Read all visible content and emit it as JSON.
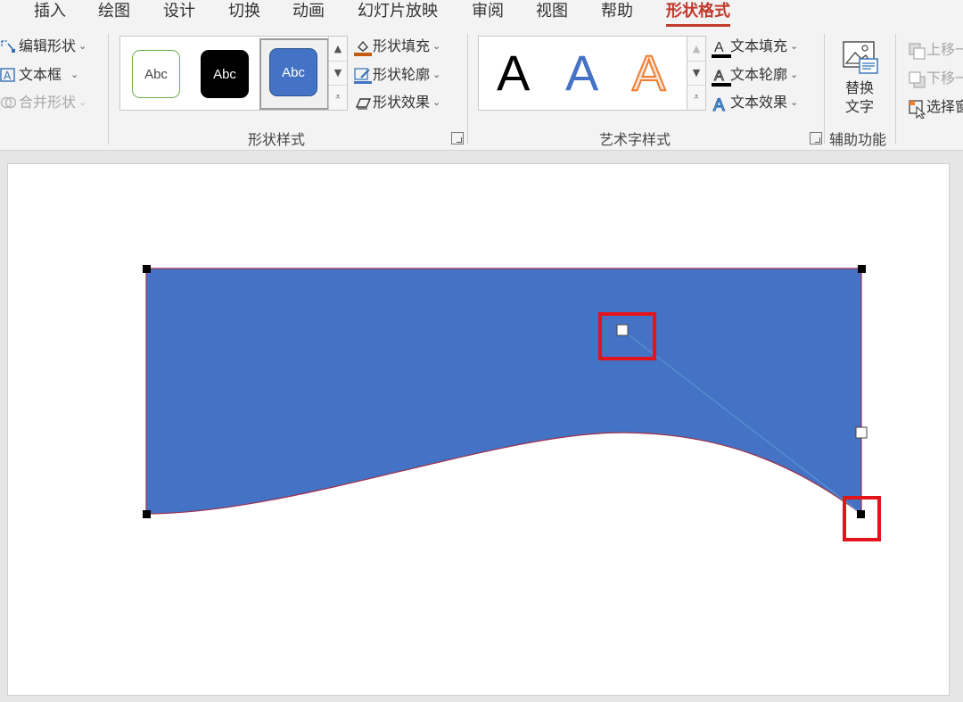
{
  "tabs": [
    {
      "label": "插入"
    },
    {
      "label": "绘图"
    },
    {
      "label": "设计"
    },
    {
      "label": "切换"
    },
    {
      "label": "动画"
    },
    {
      "label": "幻灯片放映"
    },
    {
      "label": "审阅"
    },
    {
      "label": "视图"
    },
    {
      "label": "帮助"
    },
    {
      "label": "形状格式"
    }
  ],
  "active_tab": "形状格式",
  "insert_shapes": {
    "edit_shape": "编辑形状",
    "text_box": "文本框",
    "merge_shapes": "合并形状"
  },
  "shape_styles": {
    "label": "形状样式",
    "gallery": [
      {
        "text": "Abc",
        "style": "outline-green"
      },
      {
        "text": "Abc",
        "style": "black-fill"
      },
      {
        "text": "Abc",
        "style": "blue-fill-selected"
      }
    ],
    "fill": "形状填充",
    "outline": "形状轮廓",
    "effects": "形状效果"
  },
  "wordart_styles": {
    "label": "艺术字样式",
    "gallery": [
      {
        "text": "A",
        "style": "black"
      },
      {
        "text": "A",
        "style": "blue"
      },
      {
        "text": "A",
        "style": "orange-outline"
      }
    ],
    "text_fill": "文本填充",
    "text_outline": "文本轮廓",
    "text_effects": "文本效果"
  },
  "accessibility": {
    "label": "辅助功能",
    "alt_text_line1": "替换",
    "alt_text_line2": "文字"
  },
  "arrange": {
    "bring_forward": "上移一",
    "send_backward": "下移一",
    "selection_pane": "选择窗"
  },
  "colors": {
    "accent_tab": "#c0392b",
    "shape_fill": "#4472c4",
    "shape_outline": "#a0304a",
    "highlight_box": "#e3141b",
    "wordart_blue": "#4472c4",
    "wordart_orange": "#ed7d31",
    "gallery_green": "#70ad47"
  },
  "icons": {
    "edit_shape": "edit-shape-icon",
    "text_box": "text-box-icon",
    "merge_shapes": "merge-shapes-icon",
    "shape_fill": "paint-bucket-icon",
    "shape_outline": "pencil-outline-icon",
    "shape_effects": "shape-effects-icon",
    "text_fill": "text-fill-icon",
    "text_outline": "text-outline-icon",
    "text_effects": "text-effects-icon",
    "alt_text": "alt-text-image-icon",
    "bring_forward": "bring-forward-icon",
    "send_backward": "send-backward-icon",
    "selection_pane": "selection-pane-icon"
  }
}
